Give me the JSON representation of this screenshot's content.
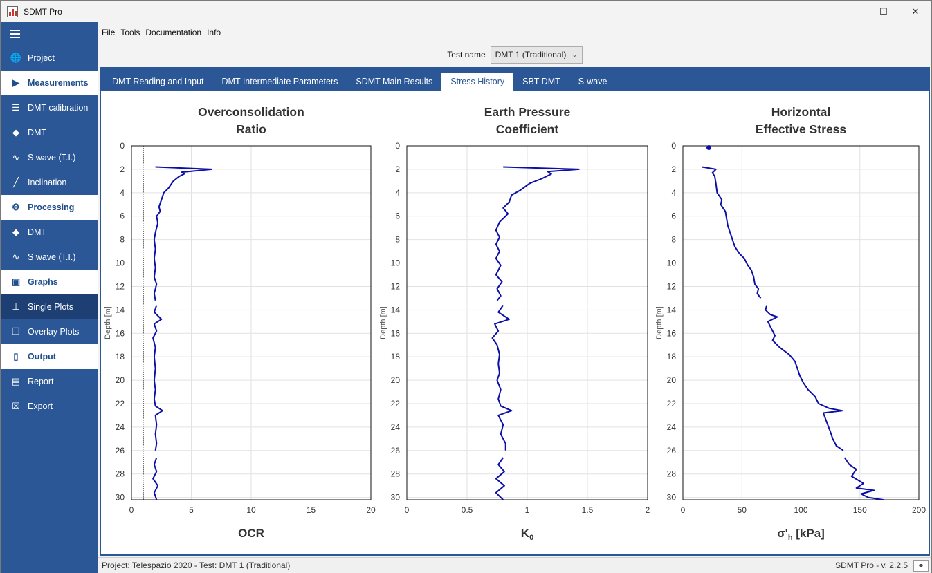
{
  "window": {
    "title": "SDMT Pro",
    "controls": {
      "minimize": "—",
      "maximize": "☐",
      "close": "✕"
    }
  },
  "sidebar": {
    "items": [
      {
        "label": "Project",
        "icon": "globe-icon",
        "glyph": "🌐",
        "kind": "item"
      },
      {
        "label": "Measurements",
        "icon": "play-icon",
        "glyph": "▶",
        "kind": "section"
      },
      {
        "label": "DMT calibration",
        "icon": "sliders-icon",
        "glyph": "☰",
        "kind": "item"
      },
      {
        "label": "DMT",
        "icon": "dmt-blade-icon",
        "glyph": "◆",
        "kind": "item"
      },
      {
        "label": "S wave (T.I.)",
        "icon": "wave-icon",
        "glyph": "∿",
        "kind": "item"
      },
      {
        "label": "Inclination",
        "icon": "inclination-icon",
        "glyph": "╱",
        "kind": "item"
      },
      {
        "label": "Processing",
        "icon": "gears-icon",
        "glyph": "⚙",
        "kind": "section"
      },
      {
        "label": "DMT",
        "icon": "dmt-blade-icon",
        "glyph": "◆",
        "kind": "item"
      },
      {
        "label": "S wave (T.I.)",
        "icon": "wave-icon",
        "glyph": "∿",
        "kind": "item"
      },
      {
        "label": "Graphs",
        "icon": "image-icon",
        "glyph": "▣",
        "kind": "section"
      },
      {
        "label": "Single Plots",
        "icon": "pin-icon",
        "glyph": "⊥",
        "kind": "active"
      },
      {
        "label": "Overlay Plots",
        "icon": "layers-icon",
        "glyph": "❐",
        "kind": "item"
      },
      {
        "label": "Output",
        "icon": "document-icon",
        "glyph": "▯",
        "kind": "section"
      },
      {
        "label": "Report",
        "icon": "pdf-icon",
        "glyph": "▤",
        "kind": "item"
      },
      {
        "label": "Export",
        "icon": "excel-icon",
        "glyph": "☒",
        "kind": "item"
      }
    ]
  },
  "menu": [
    "File",
    "Tools",
    "Documentation",
    "Info"
  ],
  "test_selector": {
    "label": "Test name",
    "value": "DMT 1 (Traditional)",
    "chevron": "⌄"
  },
  "tabs": [
    {
      "label": "DMT Reading and Input",
      "active": false
    },
    {
      "label": "DMT Intermediate Parameters",
      "active": false
    },
    {
      "label": "SDMT Main Results",
      "active": false
    },
    {
      "label": "Stress History",
      "active": true
    },
    {
      "label": "SBT DMT",
      "active": false
    },
    {
      "label": "S-wave",
      "active": false
    }
  ],
  "status": {
    "left": "Project: Telespazio 2020 - Test: DMT 1 (Traditional)",
    "right": "SDMT Pro - v. 2.2.5",
    "link_icon": "link-icon"
  },
  "chart_data": [
    {
      "type": "line",
      "title_lines": [
        "Overconsolidation",
        "Ratio"
      ],
      "xlabel": "OCR",
      "ylabel": "Depth [m]",
      "xlim": [
        0,
        20
      ],
      "ylim": [
        0,
        30.2
      ],
      "y_inverted": true,
      "xticks": [
        0,
        5,
        10,
        15,
        20
      ],
      "xtick_labels": [
        "0",
        "5",
        "10",
        "15",
        "20"
      ],
      "yticks": [
        0,
        2,
        4,
        6,
        8,
        10,
        12,
        14,
        16,
        18,
        20,
        22,
        24,
        26,
        28,
        30
      ],
      "grid": true,
      "color": "#0b0fa8",
      "reference_line": {
        "x": 1,
        "style": "dotted"
      },
      "series": [
        {
          "points": [
            [
              2.0,
              1.8
            ],
            [
              6.7,
              2.0
            ],
            [
              4.2,
              2.25
            ],
            [
              4.4,
              2.4
            ],
            [
              4.0,
              2.6
            ],
            [
              3.5,
              3.0
            ],
            [
              3.1,
              3.6
            ],
            [
              2.7,
              4.0
            ],
            [
              2.5,
              4.6
            ],
            [
              2.3,
              5.2
            ],
            [
              2.4,
              5.6
            ],
            [
              2.1,
              6.0
            ],
            [
              2.2,
              6.6
            ],
            [
              2.0,
              7.4
            ],
            [
              1.9,
              8.0
            ],
            [
              2.0,
              8.8
            ],
            [
              1.9,
              9.6
            ],
            [
              2.0,
              10.4
            ],
            [
              1.9,
              11.2
            ],
            [
              2.1,
              11.8
            ],
            [
              1.9,
              12.6
            ],
            [
              2.0,
              13.2
            ]
          ]
        },
        {
          "points": [
            [
              2.1,
              13.6
            ],
            [
              1.9,
              14.2
            ],
            [
              2.5,
              14.8
            ],
            [
              1.9,
              15.2
            ],
            [
              2.1,
              15.8
            ],
            [
              1.8,
              16.4
            ],
            [
              2.0,
              17.2
            ],
            [
              1.9,
              18.0
            ],
            [
              2.0,
              19.0
            ],
            [
              1.9,
              20.0
            ],
            [
              2.0,
              20.8
            ],
            [
              1.9,
              21.6
            ],
            [
              2.0,
              22.2
            ],
            [
              2.6,
              22.6
            ],
            [
              2.0,
              23.0
            ],
            [
              2.1,
              23.8
            ],
            [
              2.0,
              24.6
            ],
            [
              2.1,
              25.4
            ],
            [
              2.0,
              26.0
            ]
          ]
        },
        {
          "points": [
            [
              2.1,
              26.6
            ],
            [
              1.9,
              27.2
            ],
            [
              2.1,
              27.8
            ],
            [
              1.8,
              28.4
            ],
            [
              2.2,
              29.0
            ],
            [
              1.9,
              29.6
            ],
            [
              2.1,
              30.2
            ]
          ]
        }
      ]
    },
    {
      "type": "line",
      "title_lines": [
        "Earth Pressure",
        "Coefficient"
      ],
      "xlabel": "K0",
      "xlabel_main": "K",
      "xlabel_sub": "0",
      "ylabel": "Depth [m]",
      "xlim": [
        0,
        2
      ],
      "ylim": [
        0,
        30.2
      ],
      "y_inverted": true,
      "xticks": [
        0,
        0.5,
        1,
        1.5,
        2
      ],
      "xtick_labels": [
        "0",
        "0.5",
        "1",
        "1.5",
        "2"
      ],
      "yticks": [
        0,
        2,
        4,
        6,
        8,
        10,
        12,
        14,
        16,
        18,
        20,
        22,
        24,
        26,
        28,
        30
      ],
      "grid": true,
      "color": "#0b0fa8",
      "series": [
        {
          "points": [
            [
              0.8,
              1.8
            ],
            [
              1.43,
              2.0
            ],
            [
              1.17,
              2.2
            ],
            [
              1.2,
              2.4
            ],
            [
              1.12,
              2.8
            ],
            [
              1.02,
              3.2
            ],
            [
              0.94,
              3.8
            ],
            [
              0.87,
              4.2
            ],
            [
              0.85,
              4.8
            ],
            [
              0.8,
              5.3
            ],
            [
              0.84,
              5.8
            ],
            [
              0.77,
              6.5
            ],
            [
              0.74,
              7.2
            ],
            [
              0.77,
              7.8
            ],
            [
              0.74,
              8.4
            ],
            [
              0.77,
              9.0
            ],
            [
              0.74,
              9.6
            ],
            [
              0.78,
              10.2
            ],
            [
              0.74,
              11.0
            ],
            [
              0.79,
              11.6
            ],
            [
              0.75,
              12.2
            ],
            [
              0.78,
              12.8
            ],
            [
              0.75,
              13.2
            ]
          ]
        },
        {
          "points": [
            [
              0.8,
              13.6
            ],
            [
              0.76,
              14.2
            ],
            [
              0.85,
              14.8
            ],
            [
              0.73,
              15.2
            ],
            [
              0.76,
              15.8
            ],
            [
              0.71,
              16.4
            ],
            [
              0.75,
              17.0
            ],
            [
              0.77,
              17.8
            ],
            [
              0.76,
              18.6
            ],
            [
              0.77,
              19.4
            ],
            [
              0.75,
              20.0
            ],
            [
              0.78,
              20.8
            ],
            [
              0.76,
              21.6
            ],
            [
              0.78,
              22.2
            ],
            [
              0.87,
              22.6
            ],
            [
              0.76,
              23.0
            ],
            [
              0.8,
              23.8
            ],
            [
              0.78,
              24.6
            ],
            [
              0.82,
              25.4
            ],
            [
              0.82,
              26.0
            ]
          ]
        },
        {
          "points": [
            [
              0.8,
              26.6
            ],
            [
              0.76,
              27.2
            ],
            [
              0.81,
              27.8
            ],
            [
              0.74,
              28.4
            ],
            [
              0.81,
              29.0
            ],
            [
              0.74,
              29.6
            ],
            [
              0.8,
              30.2
            ]
          ]
        }
      ]
    },
    {
      "type": "line",
      "title_lines": [
        "Horizontal",
        "Effective Stress"
      ],
      "xlabel": "σ'h [kPa]",
      "xlabel_main": "σ'",
      "xlabel_sub": "h",
      "xlabel_tail": " [kPa]",
      "ylabel": "Depth [m]",
      "xlim": [
        0,
        200
      ],
      "ylim": [
        0,
        30.2
      ],
      "y_inverted": true,
      "xticks": [
        0,
        50,
        100,
        150,
        200
      ],
      "xtick_labels": [
        "0",
        "50",
        "100",
        "150",
        "200"
      ],
      "yticks": [
        0,
        2,
        4,
        6,
        8,
        10,
        12,
        14,
        16,
        18,
        20,
        22,
        24,
        26,
        28,
        30
      ],
      "grid": true,
      "color": "#0b0fa8",
      "marker_point": [
        22,
        0.15
      ],
      "series": [
        {
          "points": [
            [
              16,
              1.8
            ],
            [
              28,
              2.0
            ],
            [
              25,
              2.3
            ],
            [
              27,
              2.6
            ],
            [
              28,
              3.2
            ],
            [
              29,
              4.0
            ],
            [
              33,
              4.6
            ],
            [
              32,
              5.0
            ],
            [
              36,
              5.6
            ],
            [
              37,
              6.2
            ],
            [
              38,
              6.8
            ],
            [
              40,
              7.4
            ],
            [
              42,
              8.0
            ],
            [
              44,
              8.6
            ],
            [
              48,
              9.2
            ],
            [
              52,
              9.6
            ],
            [
              55,
              10.2
            ],
            [
              58,
              10.6
            ],
            [
              60,
              11.2
            ],
            [
              61,
              11.8
            ],
            [
              64,
              12.2
            ],
            [
              63,
              12.6
            ],
            [
              66,
              13.0
            ]
          ]
        },
        {
          "points": [
            [
              71,
              13.6
            ],
            [
              70,
              14.0
            ],
            [
              74,
              14.4
            ],
            [
              80,
              14.6
            ],
            [
              72,
              15.0
            ],
            [
              75,
              15.6
            ],
            [
              78,
              16.2
            ],
            [
              76,
              16.6
            ],
            [
              82,
              17.2
            ],
            [
              90,
              17.8
            ],
            [
              95,
              18.4
            ],
            [
              97,
              19.0
            ],
            [
              99,
              19.6
            ],
            [
              102,
              20.2
            ],
            [
              106,
              20.8
            ],
            [
              112,
              21.4
            ],
            [
              115,
              22.0
            ],
            [
              124,
              22.4
            ],
            [
              135,
              22.6
            ],
            [
              119,
              22.8
            ],
            [
              122,
              23.6
            ],
            [
              125,
              24.4
            ],
            [
              127,
              25.0
            ],
            [
              130,
              25.6
            ],
            [
              136,
              26.0
            ]
          ]
        },
        {
          "points": [
            [
              137,
              26.6
            ],
            [
              141,
              27.2
            ],
            [
              147,
              27.6
            ],
            [
              143,
              28.2
            ],
            [
              153,
              28.8
            ],
            [
              147,
              29.2
            ],
            [
              162,
              29.4
            ],
            [
              151,
              29.7
            ],
            [
              157,
              30.0
            ],
            [
              170,
              30.2
            ]
          ]
        }
      ]
    }
  ]
}
